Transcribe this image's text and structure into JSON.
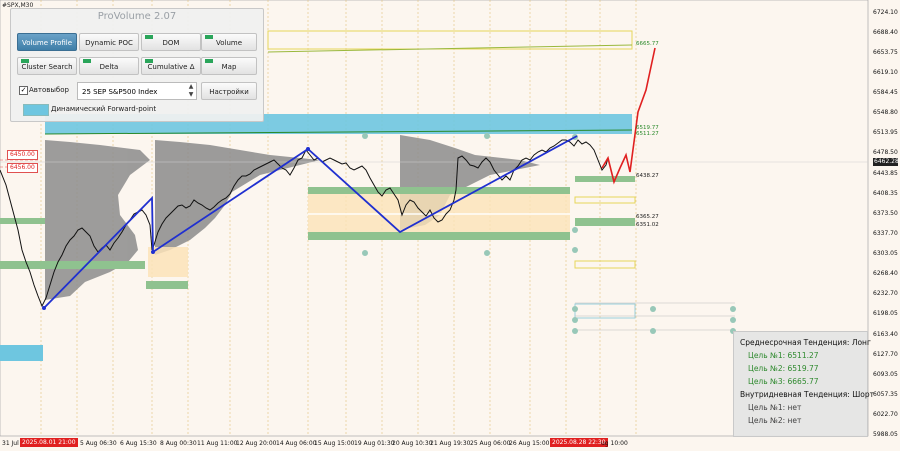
{
  "symbol": "#SPX,M30",
  "current_price": "6462.28",
  "price_axis": [
    "6724.10",
    "6688.40",
    "6653.75",
    "6619.10",
    "6584.45",
    "6548.80",
    "6513.95",
    "6478.50",
    "6443.85",
    "6408.35",
    "6373.50",
    "6337.70",
    "6303.05",
    "6268.40",
    "6232.70",
    "6198.05",
    "6163.40",
    "6127.70",
    "6093.05",
    "6057.35",
    "6022.70",
    "5988.05"
  ],
  "time_axis": [
    "31 Jul",
    "5 Aug 06:30",
    "6 Aug 15:30",
    "8 Aug 00:30",
    "11 Aug 11:00",
    "12 Aug 20:00",
    "14 Aug 06:00",
    "15 Aug 15:00",
    "19 Aug 01:30",
    "20 Aug 10:30",
    "21 Aug 19:30",
    "25 Aug 06:00",
    "26 Aug 15:00",
    "ug 10:00"
  ],
  "time_highlight": [
    "2025.08.01 21:00",
    "2025.08.28 22:30"
  ],
  "left_tags": [
    "6450.00",
    "6456.00"
  ],
  "price_labels": {
    "l1": "6665.77",
    "l2": "6519.77",
    "l3": "6511.27",
    "l4": "6438.27",
    "l5": "6365.27",
    "l6": "6351.02"
  },
  "panel": {
    "title": "ProVolume 2.07",
    "buttons": {
      "volume_profile": "Volume Profile",
      "dynamic_poc": "Dynamic POC",
      "dom": "DOM",
      "volume": "Volume",
      "cluster_search": "Cluster Search",
      "delta": "Delta",
      "cumulative_delta": "Cumulative Δ",
      "map": "Map",
      "settings": "Настройки"
    },
    "autoselect_label": "Автовыбор",
    "autoselect_checked": "✓",
    "instrument": "25 SEP S&P500 Index",
    "forward_point_label": "Динамический Forward-point"
  },
  "info": {
    "mid_trend": "Среднесрочная Тенденция: Лонг",
    "target1": "Цель №1: 6511.27",
    "target2": "Цель №2: 6519.77",
    "target3": "Цель №3: 6665.77",
    "intraday_trend": "Внутридневная Тенденция: Шорт",
    "intraday_target1": "Цель №1: нет",
    "intraday_target2": "Цель №2: нет"
  },
  "colors": {
    "background": "#fcf6ef",
    "zone_blue": "#6ec6e0",
    "zone_green": "#8fc28f",
    "zigzag": "#2030d0",
    "forecast": "#e02020",
    "profile_gray": "#8c8c8c",
    "target_green": "#2f8a2f"
  }
}
